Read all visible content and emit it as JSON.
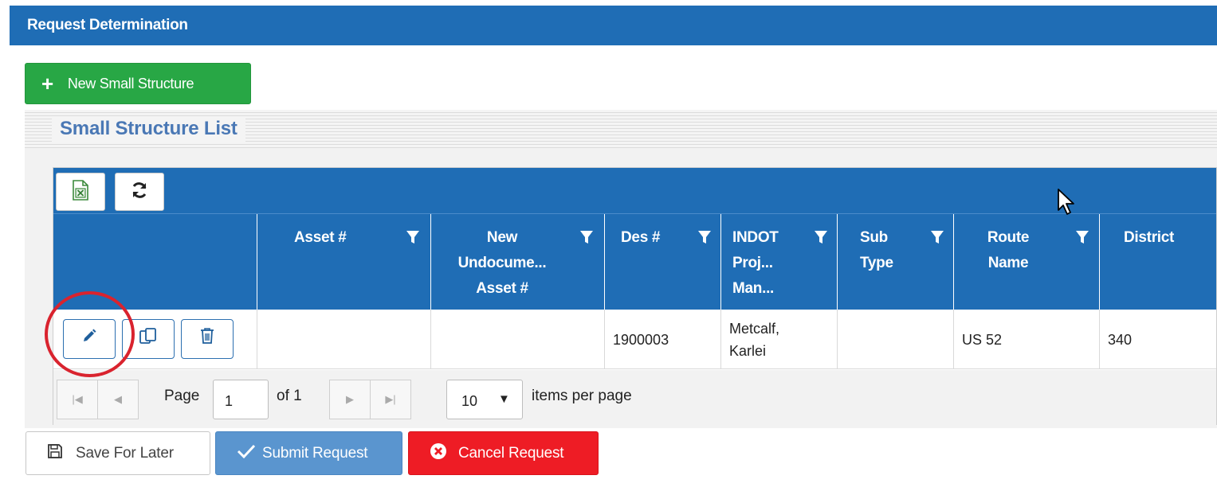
{
  "panel": {
    "title": "Request Determination"
  },
  "new_button": {
    "icon": "plus-icon",
    "label": "New Small Structure"
  },
  "section": {
    "title": "Small Structure List"
  },
  "toolbar": {
    "export_icon": "excel-export-icon",
    "refresh_icon": "refresh-icon"
  },
  "columns": [
    {
      "key": "actions",
      "label": ""
    },
    {
      "key": "asset",
      "label": "Asset #"
    },
    {
      "key": "new_undoc",
      "label": "New\nUndocume...\nAsset #"
    },
    {
      "key": "des",
      "label": "Des #"
    },
    {
      "key": "indot_pm",
      "label": "INDOT\nProj...\nMan..."
    },
    {
      "key": "sub_type",
      "label": "Sub\nType"
    },
    {
      "key": "route",
      "label": "Route\nName"
    },
    {
      "key": "district",
      "label": "District"
    }
  ],
  "rows": [
    {
      "asset": "",
      "new_undoc": "",
      "des": "1900003",
      "indot_pm": "Metcalf,\nKarlei",
      "sub_type": "",
      "route": "US 52",
      "district": "340"
    }
  ],
  "row_actions": [
    "edit-icon",
    "copy-icon",
    "delete-icon"
  ],
  "pager": {
    "page_label": "Page",
    "page": "1",
    "of_label": "of 1",
    "page_size": "10",
    "items_label": "items per page"
  },
  "actions": {
    "save": "Save For Later",
    "submit": "Submit Request",
    "cancel": "Cancel Request"
  },
  "colors": {
    "header_blue": "#1f6db5",
    "green": "#28a745",
    "red": "#ee1c25",
    "submit_blue": "#5a95cf",
    "highlight_circle": "#d9232e"
  }
}
